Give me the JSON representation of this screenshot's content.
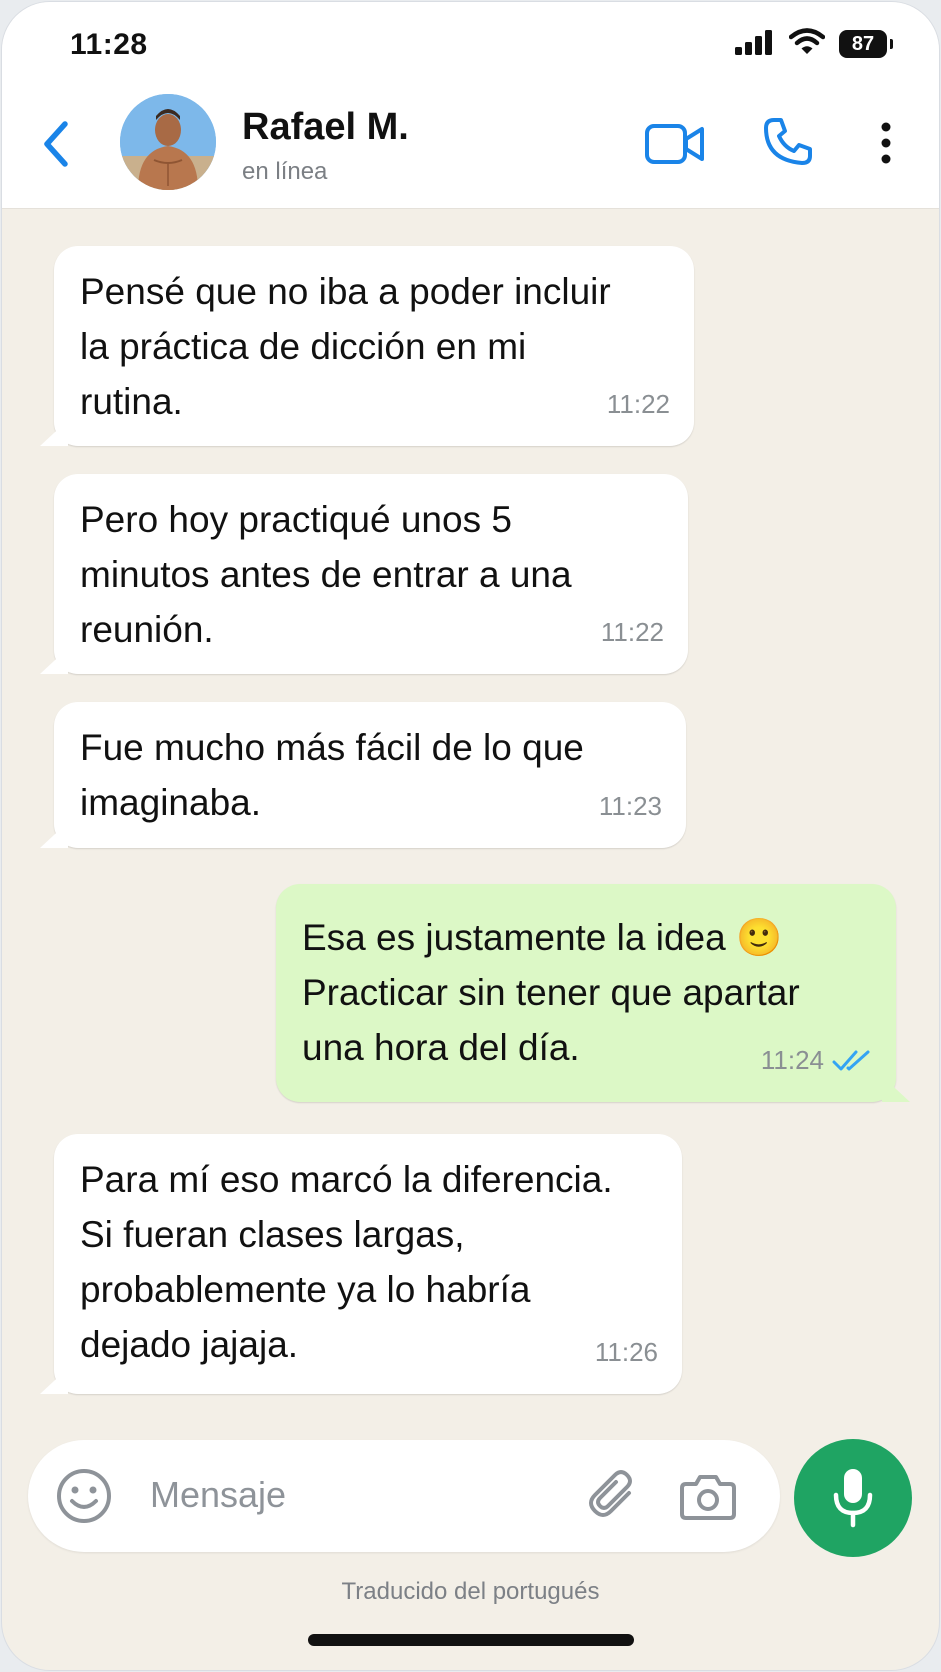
{
  "status_bar": {
    "time": "11:28",
    "battery": "87"
  },
  "header": {
    "contact_name": "Rafael M.",
    "contact_status": "en línea"
  },
  "messages": [
    {
      "direction": "incoming",
      "text": "Pensé que no iba a poder incluir\nla práctica de dicción en mi\nrutina.",
      "time": "11:22"
    },
    {
      "direction": "incoming",
      "text": "Pero hoy practiqué unos 5\nminutos antes de entrar a una\nreunión.",
      "time": "11:22"
    },
    {
      "direction": "incoming",
      "text": "Fue mucho más fácil de lo que\nimaginaba.",
      "time": "11:23"
    },
    {
      "direction": "outgoing",
      "text": "Esa es justamente la idea 🙂\nPracticar sin tener que apartar\nuna hora del día.",
      "time": "11:24",
      "status": "read"
    },
    {
      "direction": "incoming",
      "text": "Para mí eso marcó la diferencia.\nSi fueran clases largas,\nprobablemente ya lo habría\ndejado jajaja.",
      "time": "11:26"
    }
  ],
  "composer": {
    "placeholder": "Mensaje"
  },
  "footer": {
    "note": "Traducido del portugués"
  },
  "colors": {
    "accent": "#1a84e8",
    "mic": "#1fa463",
    "outgoing_bubble": "#dcf8c6",
    "chat_bg": "#f3efe7",
    "read_ticks": "#34a4f3"
  },
  "icons": [
    "signal-icon",
    "wifi-icon",
    "battery-icon",
    "back-chevron-icon",
    "video-call-icon",
    "phone-call-icon",
    "more-vert-icon",
    "emoji-icon",
    "attach-icon",
    "camera-icon",
    "microphone-icon",
    "double-check-icon"
  ]
}
